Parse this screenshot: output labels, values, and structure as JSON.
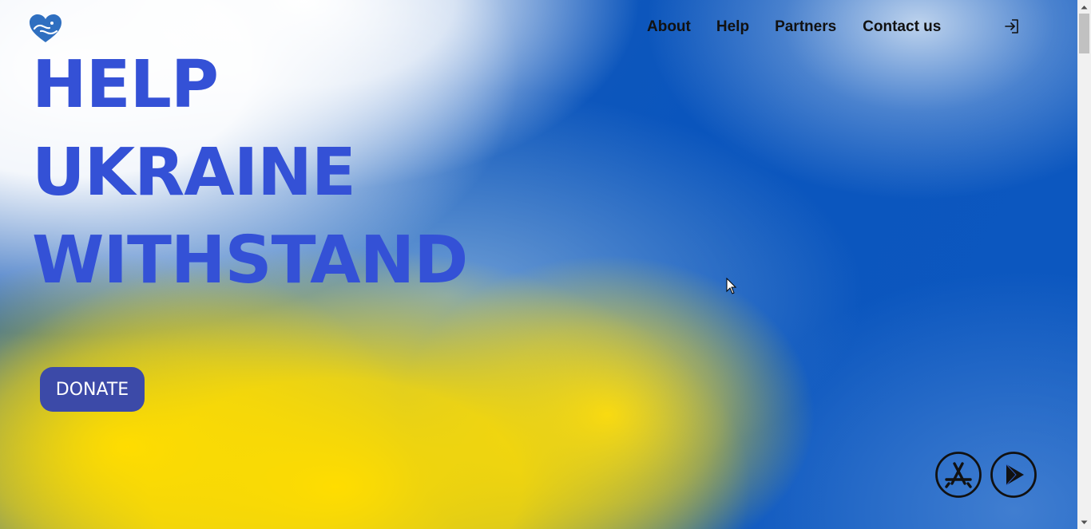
{
  "nav": {
    "items": [
      {
        "label": "About"
      },
      {
        "label": "Help"
      },
      {
        "label": "Partners"
      },
      {
        "label": "Contact us"
      }
    ]
  },
  "icons": {
    "logo": "heart-hands-logo",
    "login": "login-icon",
    "app_store": "app-store-icon",
    "play_store": "google-play-icon"
  },
  "hero": {
    "line1": "HELP",
    "line2": "UKRAINE",
    "line3": "WITHSTAND"
  },
  "donate": {
    "label": "DONATE"
  },
  "colors": {
    "hero_text": "#3451d6",
    "donate_bg": "#3c4aa8",
    "flag_blue": "#0a55bd",
    "flag_yellow": "#ffdd00",
    "logo": "#2f6fc0"
  }
}
